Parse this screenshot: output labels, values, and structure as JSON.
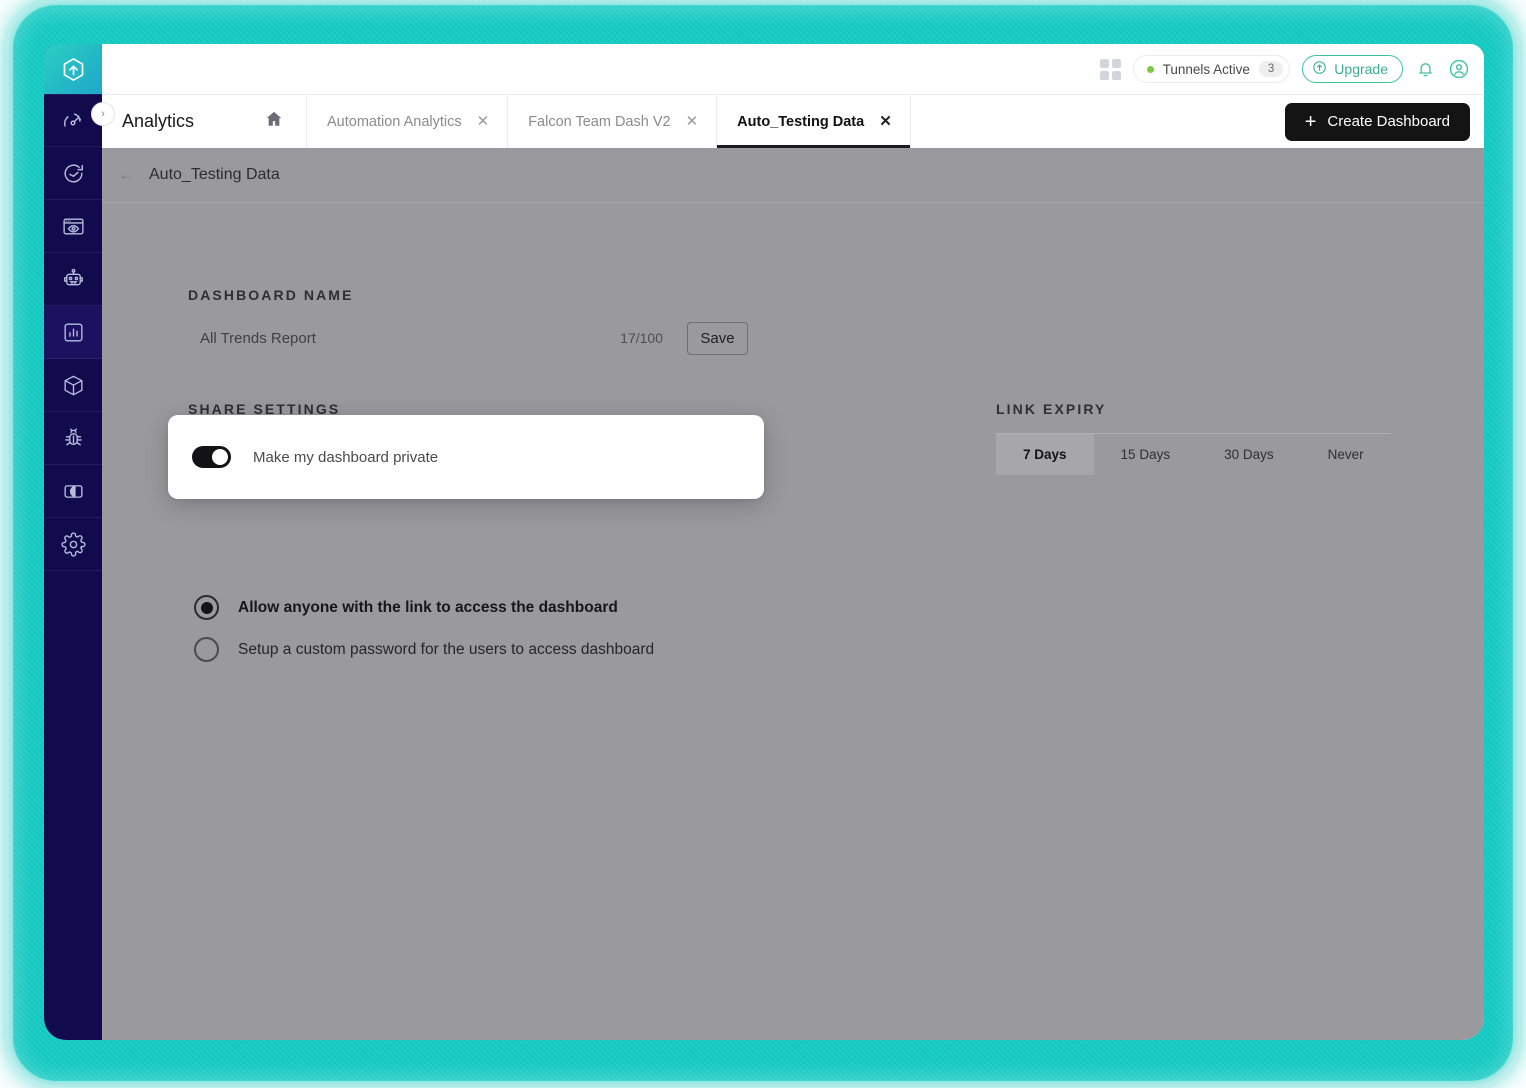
{
  "brand": {
    "accent_teal": "#2ad0c2",
    "sidebar_bg": "#110b4e",
    "overlay_gray": "#9a9a9e",
    "logo_name": "browserstack-logo-icon",
    "collapse_icon": "›"
  },
  "topbar": {
    "grid_icon": "grid-apps-icon",
    "tunnels": {
      "label": "Tunnels Active",
      "count": "3",
      "status_color": "#7ac943"
    },
    "upgrade": {
      "label": "Upgrade",
      "icon": "arrow-up-circle-icon"
    },
    "notifications_icon": "bell-icon",
    "account_icon": "user-avatar-icon"
  },
  "sidebar": {
    "items": [
      {
        "name": "sidebar-item-speedlab",
        "icon": "speedometer-icon",
        "active": false
      },
      {
        "name": "sidebar-item-history",
        "icon": "clock-rewind-icon",
        "active": false
      },
      {
        "name": "sidebar-item-live",
        "icon": "browser-eye-icon",
        "active": false
      },
      {
        "name": "sidebar-item-automate",
        "icon": "robot-icon",
        "active": false
      },
      {
        "name": "sidebar-item-analytics",
        "icon": "bar-chart-icon",
        "active": true
      },
      {
        "name": "sidebar-item-app-automate",
        "icon": "package-box-icon",
        "active": false
      },
      {
        "name": "sidebar-item-test-reporting",
        "icon": "bug-icon",
        "active": false
      },
      {
        "name": "sidebar-item-percy",
        "icon": "visual-compare-icon",
        "active": false
      },
      {
        "name": "sidebar-item-settings",
        "icon": "gear-icon",
        "active": false
      }
    ]
  },
  "tabbar": {
    "product_title": "Analytics",
    "home_icon": "home-icon",
    "tabs": [
      {
        "label": "Automation Analytics",
        "active": false,
        "close_icon": "close-icon"
      },
      {
        "label": "Falcon Team Dash V2",
        "active": false,
        "close_icon": "close-icon"
      },
      {
        "label": "Auto_Testing Data",
        "active": true,
        "close_icon": "close-icon"
      }
    ],
    "create_dashboard": {
      "label": "Create Dashboard",
      "plus": "+"
    }
  },
  "breadcrumb": {
    "back_icon": "arrow-left-icon",
    "label": "Auto_Testing Data"
  },
  "dashboard_name": {
    "section_label": "DASHBOARD NAME",
    "value": "All Trends Report",
    "char_count": "17/100",
    "save_label": "Save"
  },
  "share_settings": {
    "section_label": "SHARE SETTINGS",
    "options": [
      {
        "label": "Allow anyone with the link to access the dashboard",
        "selected": true
      },
      {
        "label": "Setup a custom password for the users to access dashboard",
        "selected": false
      }
    ]
  },
  "private_popup": {
    "toggle_label": "Make my dashboard private",
    "toggle_on": true
  },
  "link_expiry": {
    "section_label": "LINK EXPIRY",
    "options": [
      {
        "label": "7 Days",
        "active": true
      },
      {
        "label": "15 Days",
        "active": false
      },
      {
        "label": "30 Days",
        "active": false
      },
      {
        "label": "Never",
        "active": false
      }
    ]
  }
}
